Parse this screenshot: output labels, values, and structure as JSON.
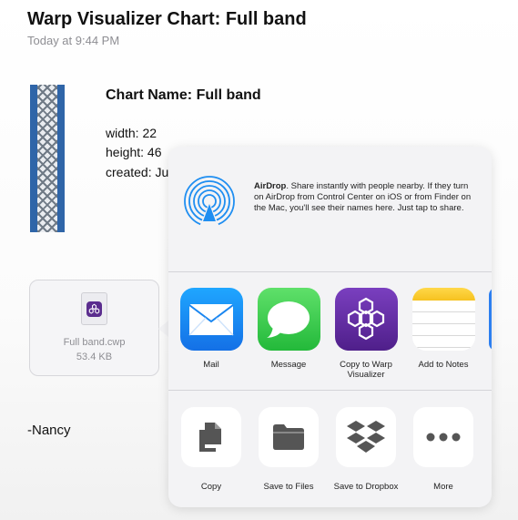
{
  "message": {
    "title": "Warp Visualizer Chart: Full band",
    "timestamp": "Today at 9:44 PM",
    "chart_name": "Chart Name: Full band",
    "width_line": "width: 22",
    "height_line": "height: 46",
    "created_line": "created: Ju",
    "attachment": {
      "filename": "Full band.cwp",
      "size": "53.4 KB"
    },
    "signature": "-Nancy"
  },
  "share_sheet": {
    "airdrop": {
      "title": "AirDrop",
      "description": ". Share instantly with people nearby. If they turn on AirDrop from Control Center on iOS or from Finder on the Mac, you'll see their names here. Just tap to share."
    },
    "apps": [
      {
        "label": "Mail",
        "icon": "mail-icon"
      },
      {
        "label": "Message",
        "icon": "message-icon"
      },
      {
        "label": "Copy to Warp Visualizer",
        "icon": "warp-visualizer-icon"
      },
      {
        "label": "Add to Notes",
        "icon": "notes-icon"
      }
    ],
    "actions": [
      {
        "label": "Copy",
        "icon": "copy-icon"
      },
      {
        "label": "Save to Files",
        "icon": "folder-icon"
      },
      {
        "label": "Save to Dropbox",
        "icon": "dropbox-icon"
      },
      {
        "label": "More",
        "icon": "more-icon"
      }
    ]
  },
  "colors": {
    "band_blue": "#2f65a8",
    "warp_purple": "#5b2d8e",
    "airdrop_blue": "#1f8ef1"
  }
}
